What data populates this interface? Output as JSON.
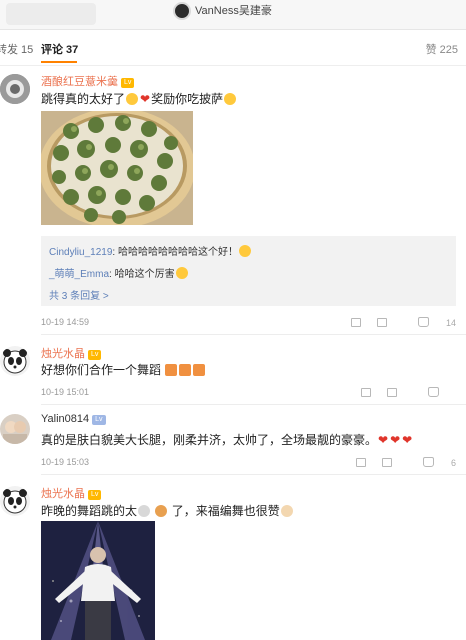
{
  "header": {
    "username": "VanNess吴建豪"
  },
  "tabs": {
    "repost": "转发 15",
    "comments": "评论 37",
    "likes": "赞 225"
  },
  "comments": [
    {
      "username": "酒酿红豆薏米羹",
      "badge": "Lv",
      "text": "跳得真的太好了",
      "text2": "奖励你吃披萨",
      "replies": [
        {
          "name": "Cindyliu_1219",
          "text": ": 哈哈哈哈哈哈哈哈这个好！"
        },
        {
          "name": "_萌萌_Emma",
          "text": ": 哈哈这个厉害"
        }
      ],
      "more": "共 3 条回复 >",
      "time": "10-19 14:59",
      "likes": "14"
    },
    {
      "username": "烛光水晶",
      "badge": "Lv",
      "text": "好想你们合作一个舞蹈",
      "time": "10-19 15:01",
      "likes": ""
    },
    {
      "username": "Yalin0814",
      "badge": "Lv",
      "text": "真的是肤白貌美大长腿，刚柔并济，太帅了，全场最靓的豪豪。",
      "time": "10-19 15:03",
      "likes": "6"
    },
    {
      "username": "烛光水晶",
      "badge": "Lv",
      "text": "昨晚的舞蹈跳的太",
      "text2": "了，来福编舞也很赞"
    }
  ]
}
